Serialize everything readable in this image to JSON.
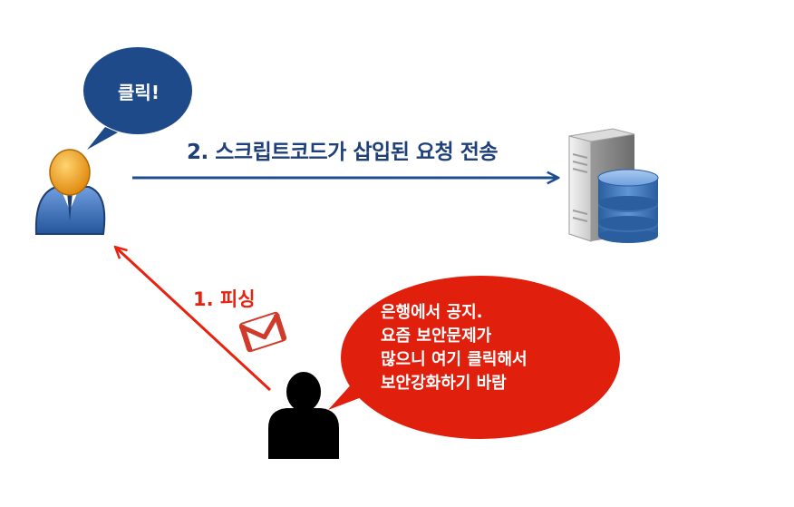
{
  "click_bubble": {
    "text": "클릭!"
  },
  "request_arrow": {
    "label": "2. 스크립트코드가 삽입된 요청 전송"
  },
  "phishing_arrow": {
    "label": "1. 피싱"
  },
  "attacker_bubble": {
    "lines": [
      "은행에서 공지.",
      "요즘 보안문제가",
      "많으니 여기 클릭해서",
      "보안강화하기 바람"
    ]
  },
  "colors": {
    "victim_bubble": "#1f4a8a",
    "request_arrow": "#1e4d8c",
    "phishing": "#e8220f",
    "attacker_bubble": "#e01f0c",
    "attacker": "#000000",
    "victim_head": "#f0a020",
    "victim_body": "#3d6fb6"
  },
  "icons": [
    "user-icon",
    "server-database-icon",
    "gmail-icon",
    "attacker-silhouette-icon"
  ]
}
